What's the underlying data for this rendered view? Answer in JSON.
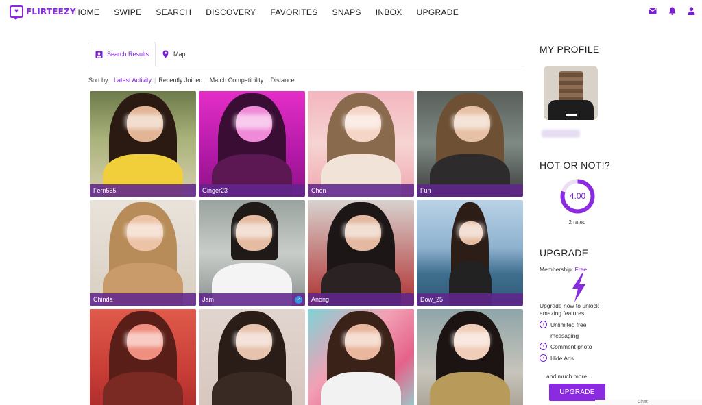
{
  "brand": {
    "name": "FLIRTEEZY",
    "color": "#8a2be2"
  },
  "nav": [
    "HOME",
    "SWIPE",
    "SEARCH",
    "DISCOVERY",
    "FAVORITES",
    "SNAPS",
    "INBOX",
    "UPGRADE"
  ],
  "top_icons": [
    "mail-icon",
    "bell-icon",
    "user-icon"
  ],
  "tabs": [
    {
      "label": "Search Results",
      "icon": "user-square-icon",
      "active": true
    },
    {
      "label": "Map",
      "icon": "map-pin-icon",
      "active": false
    }
  ],
  "sort": {
    "label": "Sort by:",
    "options": [
      "Latest Activity",
      "Recently Joined",
      "Match Compatibility",
      "Distance"
    ],
    "active": "Latest Activity"
  },
  "profiles": [
    {
      "name": "Fern555",
      "verified": false
    },
    {
      "name": "Ginger23",
      "verified": false
    },
    {
      "name": "Chen",
      "verified": false
    },
    {
      "name": "Fun",
      "verified": false
    },
    {
      "name": "Chinda",
      "verified": false
    },
    {
      "name": "Jam",
      "verified": true
    },
    {
      "name": "Anong",
      "verified": false
    },
    {
      "name": "Dow_25",
      "verified": false
    },
    {
      "name": "",
      "verified": false
    },
    {
      "name": "",
      "verified": false
    },
    {
      "name": "",
      "verified": false
    },
    {
      "name": "",
      "verified": false
    }
  ],
  "sidebar": {
    "profile_heading": "MY PROFILE",
    "hot_heading": "HOT OR NOT!?",
    "rating": "4.00",
    "rating_fraction": 0.8,
    "rated_text": "2 rated",
    "upgrade_heading": "UPGRADE",
    "membership_label": "Membership:",
    "membership_value": "Free",
    "upsell_text": "Upgrade now to unlock amazing features:",
    "features": [
      "Unlimited free messaging",
      "Comment photo",
      "Hide Ads"
    ],
    "more_text": "and much more...",
    "upgrade_button": "UPGRADE",
    "chat_label": "Chat"
  },
  "colors": {
    "accent": "#7b1fd4",
    "nameplate": "#60268c"
  }
}
